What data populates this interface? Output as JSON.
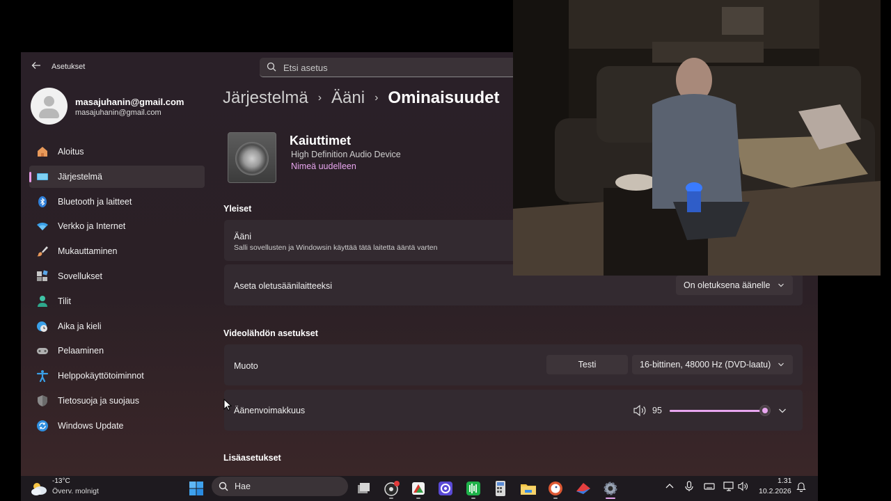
{
  "window": {
    "title": "Asetukset",
    "search_placeholder": "Etsi asetus"
  },
  "profile": {
    "name": "masajuhanin@gmail.com",
    "email": "masajuhanin@gmail.com"
  },
  "sidebar": {
    "items": [
      {
        "label": "Aloitus",
        "icon": "home-icon"
      },
      {
        "label": "Järjestelmä",
        "icon": "system-icon",
        "active": true
      },
      {
        "label": "Bluetooth ja laitteet",
        "icon": "bluetooth-icon"
      },
      {
        "label": "Verkko ja Internet",
        "icon": "wifi-icon"
      },
      {
        "label": "Mukauttaminen",
        "icon": "brush-icon"
      },
      {
        "label": "Sovellukset",
        "icon": "apps-icon"
      },
      {
        "label": "Tilit",
        "icon": "account-icon"
      },
      {
        "label": "Aika ja kieli",
        "icon": "clock-globe-icon"
      },
      {
        "label": "Pelaaminen",
        "icon": "gamepad-icon"
      },
      {
        "label": "Helppokäyttötoiminnot",
        "icon": "accessibility-icon"
      },
      {
        "label": "Tietosuoja ja suojaus",
        "icon": "shield-icon"
      },
      {
        "label": "Windows Update",
        "icon": "update-icon"
      }
    ]
  },
  "breadcrumb": {
    "parts": [
      "Järjestelmä",
      "Ääni"
    ],
    "current": "Ominaisuudet"
  },
  "device": {
    "name": "Kaiuttimet",
    "subtitle": "High Definition Audio Device",
    "rename_link": "Nimeä uudelleen"
  },
  "general": {
    "heading": "Yleiset",
    "audio_title": "Ääni",
    "audio_desc": "Salli sovellusten ja Windowsin käyttää tätä laitetta ääntä varten",
    "default_title": "Aseta oletusäänilaitteeksi",
    "default_dropdown": "On oletuksena äänelle"
  },
  "output": {
    "heading": "Videolähdön asetukset",
    "format_title": "Muoto",
    "test_button": "Testi",
    "format_dropdown": "16-bittinen, 48000 Hz (DVD-laatu)",
    "volume_title": "Äänenvoimakkuus",
    "volume_value": "95",
    "volume_level": 0.95
  },
  "more": {
    "heading": "Lisäasetukset"
  },
  "taskbar": {
    "weather_temp": "-13°C",
    "weather_desc": "Överv. molnigt",
    "search_label": "Hae",
    "time": "1.31",
    "date": "10.2.2026",
    "accent_color": "#e8a6ef"
  }
}
